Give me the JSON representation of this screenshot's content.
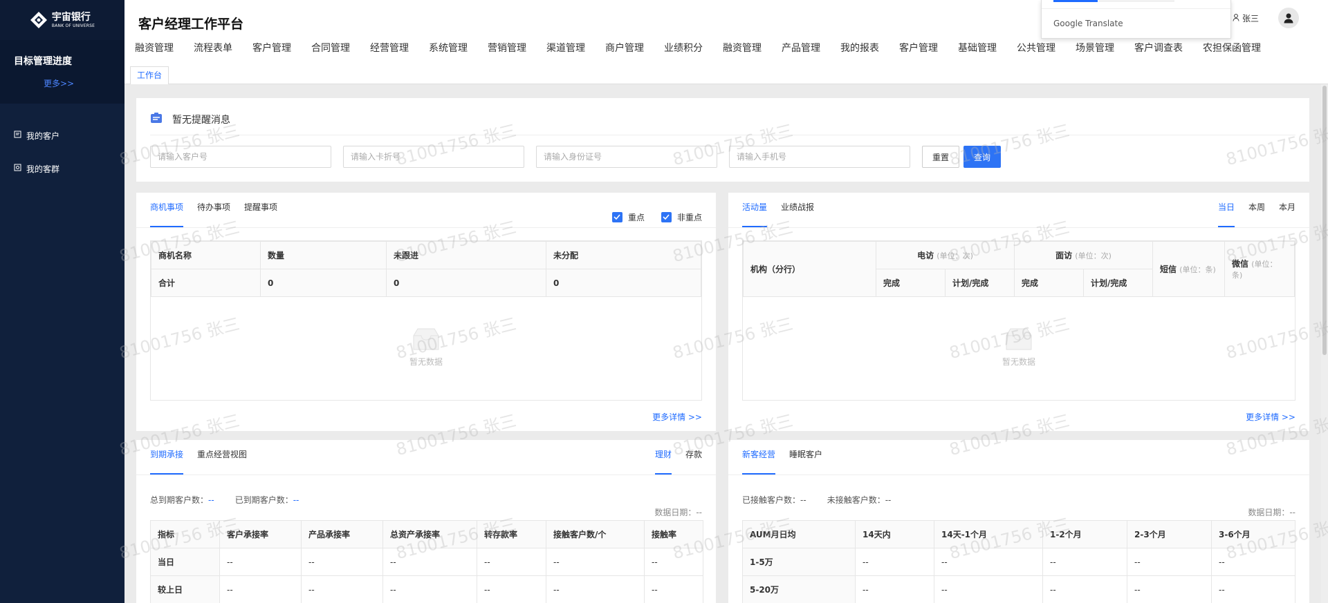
{
  "sidebar": {
    "logo_cn": "宇宙银行",
    "logo_en": "BANK OF UNIVERSE",
    "goal_title": "目标管理进度",
    "goal_more": "更多>>",
    "items": [
      {
        "label": "我的客户"
      },
      {
        "label": "我的客群"
      }
    ]
  },
  "header": {
    "title": "客户经理工作平台",
    "user": "张三",
    "nav": [
      "融资管理",
      "流程表单",
      "客户管理",
      "合同管理",
      "经营管理",
      "系统管理",
      "营销管理",
      "渠道管理",
      "商户管理",
      "业绩积分",
      "融资管理",
      "产品管理",
      "我的报表",
      "客户管理",
      "基础管理",
      "公共管理",
      "场景管理",
      "客户调查表",
      "农担保函管理"
    ],
    "tab": "工作台"
  },
  "translate": {
    "label": "Google Translate"
  },
  "reminder": {
    "text": "暂无提醒消息",
    "placeholders": {
      "customer_no": "请输入客户号",
      "card_no": "请输入卡折号",
      "id_no": "请输入身份证号",
      "phone": "请输入手机号"
    },
    "reset": "重置",
    "query": "查询"
  },
  "opportunities": {
    "tabs": [
      "商机事项",
      "待办事项",
      "提醒事项"
    ],
    "checks": [
      "重点",
      "非重点"
    ],
    "headers": [
      "商机名称",
      "数量",
      "未跟进",
      "未分配"
    ],
    "total_row": [
      "合计",
      "0",
      "0",
      "0"
    ],
    "empty": "暂无数据",
    "more": "更多详情 >>"
  },
  "activity": {
    "tabs": [
      "活动量",
      "业绩战报"
    ],
    "period_tabs": [
      "当日",
      "本周",
      "本月"
    ],
    "h_org": "机构（分行）",
    "h_call": "电访",
    "h_visit": "面访",
    "h_sms": "短信",
    "h_wechat": "微信",
    "u_times": "(单位：次)",
    "u_items": "(单位：条)",
    "sub": [
      "完成",
      "计划/完成",
      "完成",
      "计划/完成"
    ],
    "empty": "暂无数据",
    "more": "更多详情 >>"
  },
  "renewal": {
    "tabs": [
      "到期承接",
      "重点经营视图"
    ],
    "right_tabs": [
      "理财",
      "存款"
    ],
    "total_label": "总到期客户数：",
    "total_val": "--",
    "done_label": "已到期客户数：",
    "done_val": "--",
    "date": "数据日期：--",
    "headers": [
      "指标",
      "客户承接率",
      "产品承接率",
      "总资产承接率",
      "转存款率",
      "接触客户数/个",
      "接触率"
    ],
    "rows": [
      [
        "当日",
        "--",
        "--",
        "--",
        "--",
        "--",
        "--"
      ],
      [
        "较上日",
        "--",
        "--",
        "--",
        "--",
        "--",
        "--"
      ]
    ]
  },
  "newcust": {
    "tabs": [
      "新客经营",
      "睡眠客户"
    ],
    "contacted_label": "已接触客户数：",
    "contacted_val": "--",
    "uncontacted_label": "未接触客户数：",
    "uncontacted_val": "--",
    "date": "数据日期：--",
    "headers": [
      "AUM月日均",
      "14天内",
      "14天-1个月",
      "1-2个月",
      "2-3个月",
      "3-6个月"
    ],
    "rows": [
      [
        "1-5万",
        "--",
        "--",
        "--",
        "--",
        "--"
      ],
      [
        "5-20万",
        "--",
        "--",
        "--",
        "--",
        "--"
      ]
    ]
  },
  "watermark": "81001756 张三"
}
